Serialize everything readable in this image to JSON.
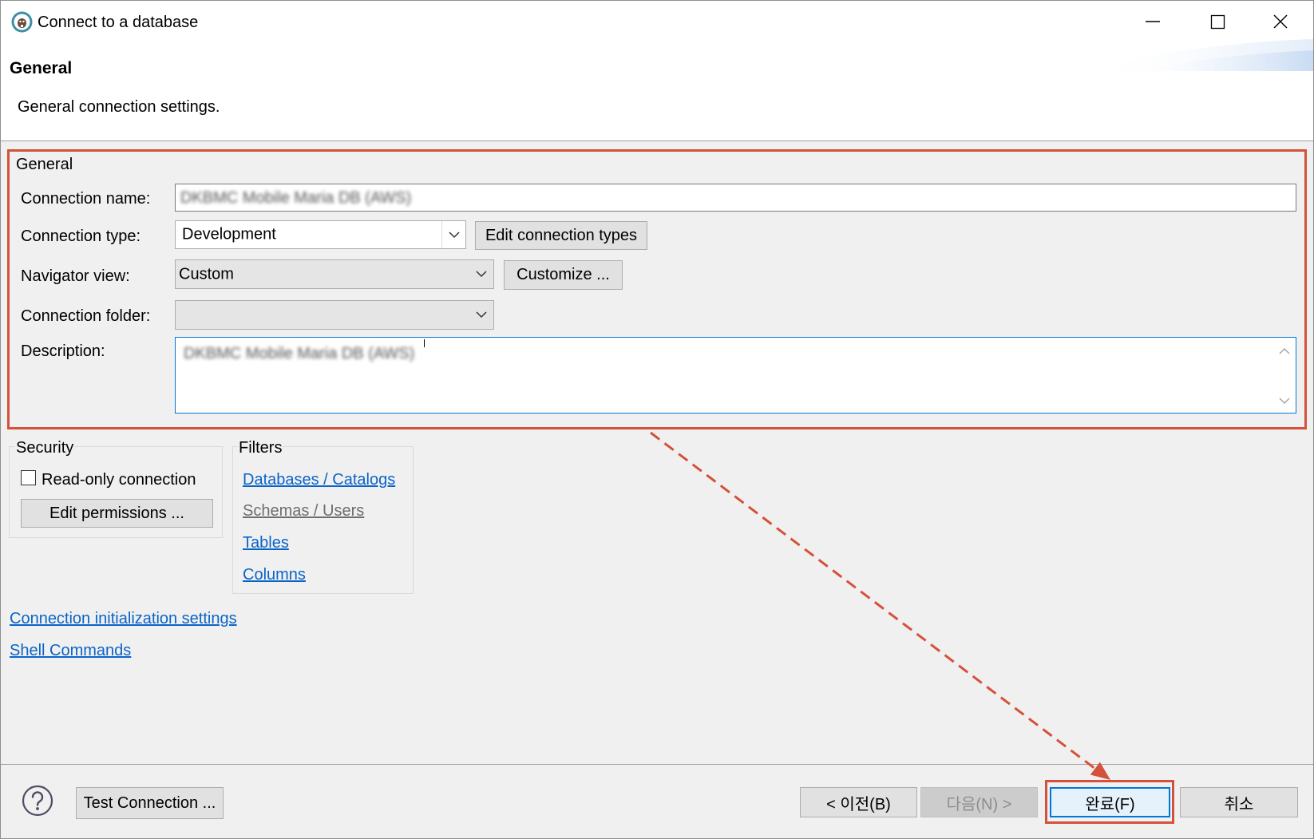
{
  "window": {
    "title": "Connect to a database",
    "app_icon": "dbeaver-app-icon",
    "controls": [
      "minimize-icon",
      "maximize-icon",
      "close-icon"
    ]
  },
  "header": {
    "title": "General",
    "subtitle": "General connection settings."
  },
  "general": {
    "group_label": "General",
    "connection_name": {
      "label": "Connection name:",
      "value": "DKBMC Mobile Maria DB (AWS)"
    },
    "connection_type": {
      "label": "Connection type:",
      "value": "Development",
      "button": "Edit connection types"
    },
    "navigator_view": {
      "label": "Navigator view:",
      "value": "Custom",
      "button": "Customize ..."
    },
    "connection_folder": {
      "label": "Connection folder:",
      "value": ""
    },
    "description": {
      "label": "Description:",
      "value": "DKBMC Mobile Maria DB (AWS)"
    }
  },
  "security": {
    "group_label": "Security",
    "read_only": {
      "label": "Read-only connection",
      "checked": false
    },
    "edit_permissions_button": "Edit permissions ..."
  },
  "filters": {
    "group_label": "Filters",
    "links": [
      {
        "label": "Databases / Catalogs",
        "enabled": true
      },
      {
        "label": "Schemas / Users",
        "enabled": false
      },
      {
        "label": "Tables",
        "enabled": true
      },
      {
        "label": "Columns",
        "enabled": true
      }
    ]
  },
  "links": {
    "connection_init": "Connection initialization settings",
    "shell_commands": "Shell Commands"
  },
  "footer": {
    "help_icon": "help-icon",
    "test_connection_button": "Test Connection ...",
    "back_button": "< 이전(B)",
    "next_button": "다음(N) >",
    "next_enabled": false,
    "finish_button": "완료(F)",
    "cancel_button": "취소"
  },
  "annotation": {
    "highlight_color": "#d4513a",
    "arrow_icon": "dashed-arrow-icon"
  },
  "colors": {
    "window_bg": "#f0f0f0",
    "link": "#0a64c8",
    "disabled_link": "#6e6e6e",
    "focus_border": "#0078d7"
  }
}
